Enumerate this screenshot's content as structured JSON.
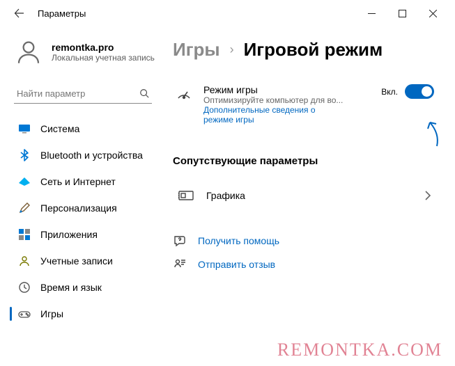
{
  "titlebar": {
    "title": "Параметры"
  },
  "profile": {
    "name": "remontka.pro",
    "sub": "Локальная учетная запись"
  },
  "search": {
    "placeholder": "Найти параметр"
  },
  "sidebar": {
    "items": [
      {
        "label": "Система"
      },
      {
        "label": "Bluetooth и устройства"
      },
      {
        "label": "Сеть и Интернет"
      },
      {
        "label": "Персонализация"
      },
      {
        "label": "Приложения"
      },
      {
        "label": "Учетные записи"
      },
      {
        "label": "Время и язык"
      },
      {
        "label": "Игры"
      }
    ]
  },
  "breadcrumb": {
    "parent": "Игры",
    "current": "Игровой режим"
  },
  "gamemode": {
    "title": "Режим игры",
    "sub": "Оптимизируйте компьютер для во...",
    "link": "Дополнительные сведения о режиме игры",
    "state_label": "Вкл."
  },
  "related": {
    "heading": "Сопутствующие параметры",
    "graphics": "Графика"
  },
  "help": {
    "get": "Получить помощь",
    "feedback": "Отправить отзыв"
  },
  "watermark": "REMONTKA.COM"
}
